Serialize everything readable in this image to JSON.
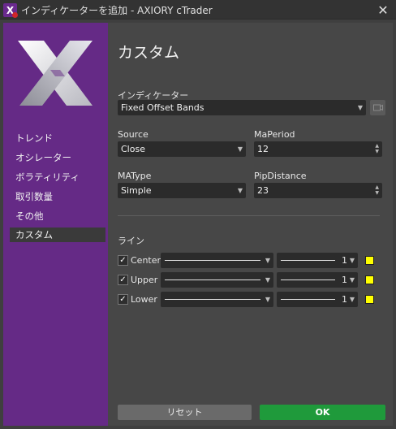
{
  "window": {
    "title": "インディケーターを追加 - AXIORY cTrader",
    "close_glyph": "✕",
    "app_icon_letter": "X"
  },
  "sidebar": {
    "items": [
      {
        "label": "トレンド",
        "active": false
      },
      {
        "label": "オシレーター",
        "active": false
      },
      {
        "label": "ボラティリティ",
        "active": false
      },
      {
        "label": "取引数量",
        "active": false
      },
      {
        "label": "その他",
        "active": false
      },
      {
        "label": "カスタム",
        "active": true
      }
    ]
  },
  "main": {
    "title": "カスタム",
    "indicator_label": "インディケーター",
    "indicator_value": "Fixed Offset Bands",
    "source_label": "Source",
    "source_value": "Close",
    "maperiod_label": "MaPeriod",
    "maperiod_value": "12",
    "matype_label": "MAType",
    "matype_value": "Simple",
    "pipdistance_label": "PipDistance",
    "pipdistance_value": "23",
    "lines_label": "ライン",
    "lines": [
      {
        "name": "Center",
        "checked": true,
        "width": "1",
        "color": "#ffff00"
      },
      {
        "name": "Upper",
        "checked": true,
        "width": "1",
        "color": "#ffff00"
      },
      {
        "name": "Lower",
        "checked": true,
        "width": "1",
        "color": "#ffff00"
      }
    ]
  },
  "buttons": {
    "reset": "リセット",
    "ok": "OK"
  },
  "colors": {
    "sidebar_bg": "#652a86",
    "ok_green": "#1f9a3b",
    "line_color": "#ffff00"
  }
}
